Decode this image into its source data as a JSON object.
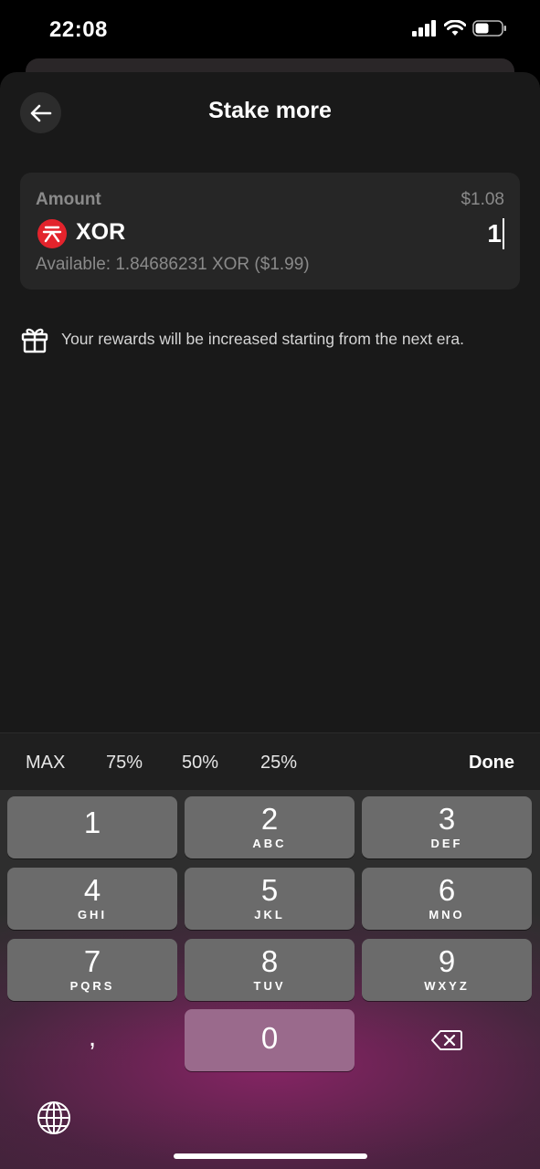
{
  "status_bar": {
    "time": "22:08",
    "icons": [
      "signal-icon",
      "wifi-icon",
      "battery-icon"
    ]
  },
  "header": {
    "title": "Stake more",
    "back_icon": "arrow-left-icon"
  },
  "amount": {
    "label": "Amount",
    "fiat_value": "$1.08",
    "token_symbol": "XOR",
    "token_icon": "xor-token-icon",
    "token_color": "#e3232c",
    "input_value": "1",
    "available": "Available: 1.84686231 XOR ($1.99)"
  },
  "info": {
    "icon": "gift-icon",
    "text": "Your rewards will be increased starting from the next era."
  },
  "accessory_bar": {
    "max": "MAX",
    "p75": "75%",
    "p50": "50%",
    "p25": "25%",
    "done": "Done"
  },
  "keypad": {
    "k1": {
      "num": "1",
      "letters": ""
    },
    "k2": {
      "num": "2",
      "letters": "ABC"
    },
    "k3": {
      "num": "3",
      "letters": "DEF"
    },
    "k4": {
      "num": "4",
      "letters": "GHI"
    },
    "k5": {
      "num": "5",
      "letters": "JKL"
    },
    "k6": {
      "num": "6",
      "letters": "MNO"
    },
    "k7": {
      "num": "7",
      "letters": "PQRS"
    },
    "k8": {
      "num": "8",
      "letters": "TUV"
    },
    "k9": {
      "num": "9",
      "letters": "WXYZ"
    },
    "k0": {
      "num": "0"
    },
    "decimal": ",",
    "delete_icon": "backspace-icon",
    "globe_icon": "globe-icon"
  },
  "colors": {
    "sheet_bg": "#191919",
    "card_bg": "#262626",
    "key_bg": "#6b6b6b",
    "accent_keyboard": "#9a6a8c"
  }
}
